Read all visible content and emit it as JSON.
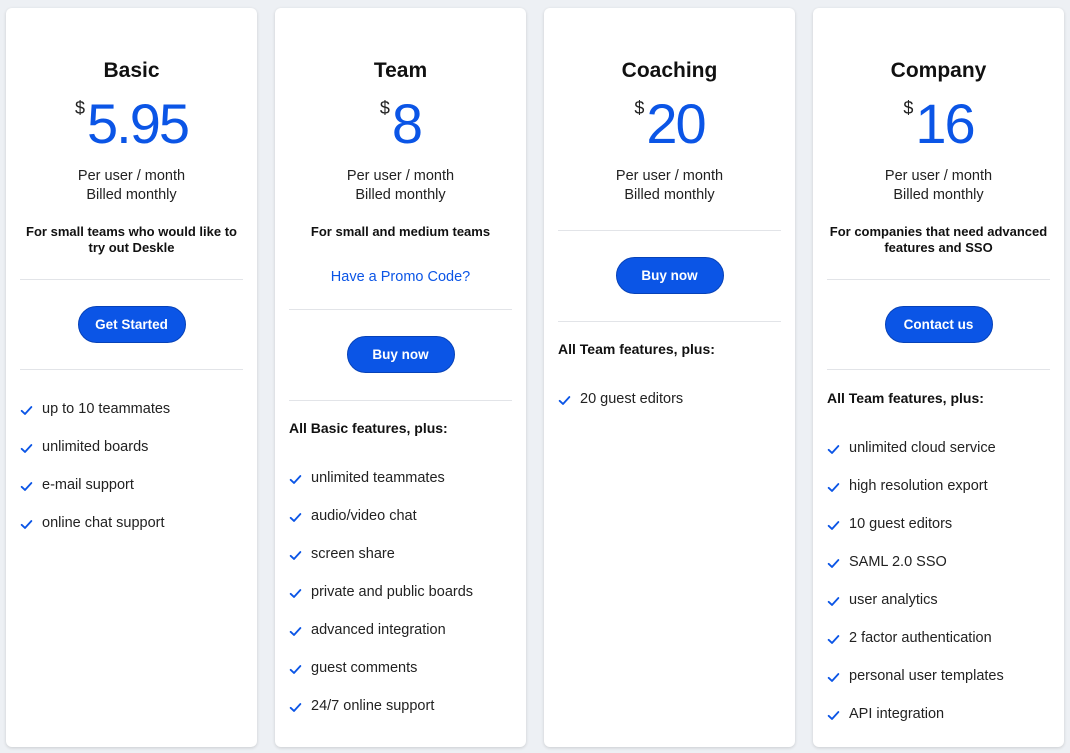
{
  "colors": {
    "accent": "#0b55e6",
    "background": "#edf0f4",
    "card": "#ffffff"
  },
  "plans": [
    {
      "name": "Basic",
      "currency": "$",
      "amount": "5.95",
      "per": "Per user / month",
      "billing": "Billed monthly",
      "description": "For small teams who would like to try out Deskle",
      "button_label": "Get Started",
      "features": [
        "up to 10 teammates",
        "unlimited boards",
        "e-mail support",
        "online chat support"
      ]
    },
    {
      "name": "Team",
      "currency": "$",
      "amount": "8",
      "per": "Per user / month",
      "billing": "Billed monthly",
      "description": "For small and medium teams",
      "promo_link": "Have a Promo Code?",
      "button_label": "Buy now",
      "features_heading": "All Basic features, plus:",
      "features": [
        "unlimited teammates",
        "audio/video chat",
        "screen share",
        "private and public boards",
        "advanced integration",
        "guest comments",
        "24/7 online support"
      ]
    },
    {
      "name": "Coaching",
      "currency": "$",
      "amount": "20",
      "per": "Per user / month",
      "billing": "Billed monthly",
      "button_label": "Buy now",
      "features_heading": "All Team features, plus:",
      "features": [
        "20 guest editors"
      ]
    },
    {
      "name": "Company",
      "currency": "$",
      "amount": "16",
      "per": "Per user / month",
      "billing": "Billed monthly",
      "description": "For companies that need advanced features and SSO",
      "button_label": "Contact us",
      "features_heading": "All Team features, plus:",
      "features": [
        "unlimited cloud service",
        "high resolution export",
        "10 guest editors",
        "SAML 2.0 SSO",
        "user analytics",
        "2 factor authentication",
        "personal user templates",
        "API integration"
      ]
    }
  ]
}
